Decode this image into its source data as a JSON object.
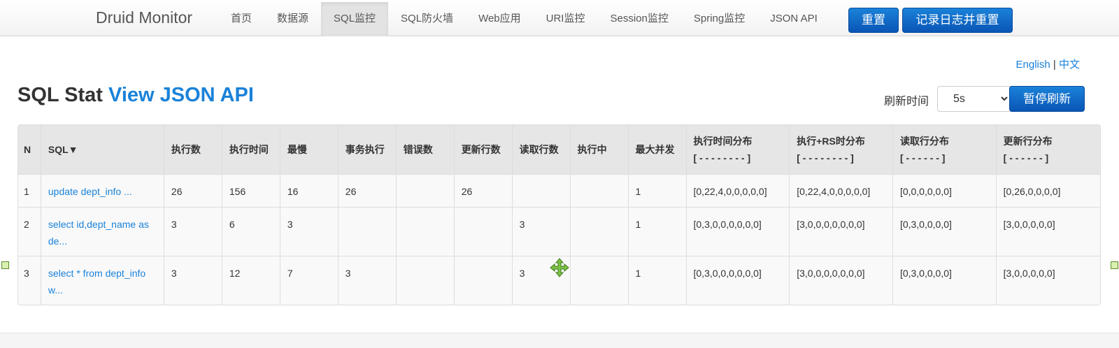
{
  "navbar": {
    "brand": "Druid Monitor",
    "items": [
      {
        "label": "首页"
      },
      {
        "label": "数据源"
      },
      {
        "label": "SQL监控"
      },
      {
        "label": "SQL防火墙"
      },
      {
        "label": "Web应用"
      },
      {
        "label": "URI监控"
      },
      {
        "label": "Session监控"
      },
      {
        "label": "Spring监控"
      },
      {
        "label": "JSON API"
      }
    ],
    "active_item": "SQL监控",
    "reset_label": "重置",
    "log_reset_label": "记录日志并重置"
  },
  "lang": {
    "english": "English",
    "separator": "|",
    "chinese": "中文"
  },
  "header": {
    "title": "SQL Stat",
    "api_link": "View JSON API",
    "refresh_label": "刷新时间",
    "refresh_value": "5s",
    "pause_label": "暂停刷新"
  },
  "table": {
    "headers": {
      "n": "N",
      "sql": "SQL▼",
      "exec_count": "执行数",
      "exec_time": "执行时间",
      "slowest": "最慢",
      "tx_exec": "事务执行",
      "error_count": "错误数",
      "update_rows": "更新行数",
      "fetch_rows": "读取行数",
      "running": "执行中",
      "max_concurrent": "最大并发",
      "exec_hist_title": "执行时间分布",
      "exec_hist_sub": "[ - - - - - - - - ]",
      "exec_rs_hist_title": "执行+RS时分布",
      "exec_rs_hist_sub": "[ - - - - - - - - ]",
      "fetch_hist_title": "读取行分布",
      "fetch_hist_sub": "[ - - - - - - ]",
      "update_hist_title": "更新行分布",
      "update_hist_sub": "[ - - - - - - ]"
    },
    "rows": [
      {
        "n": "1",
        "sql": "update dept_info ...",
        "exec_count": "26",
        "exec_time": "156",
        "slowest": "16",
        "tx_exec": "26",
        "error_count": "",
        "update_rows": "26",
        "fetch_rows": "",
        "running": "",
        "max_concurrent": "1",
        "exec_hist": "[0,22,4,0,0,0,0,0]",
        "exec_rs_hist": "[0,22,4,0,0,0,0,0]",
        "fetch_hist": "[0,0,0,0,0,0]",
        "update_hist": "[0,26,0,0,0,0]"
      },
      {
        "n": "2",
        "sql": "select id,dept_name as de...",
        "exec_count": "3",
        "exec_time": "6",
        "slowest": "3",
        "tx_exec": "",
        "error_count": "",
        "update_rows": "",
        "fetch_rows": "3",
        "running": "",
        "max_concurrent": "1",
        "exec_hist": "[0,3,0,0,0,0,0,0]",
        "exec_rs_hist": "[3,0,0,0,0,0,0,0]",
        "fetch_hist": "[0,3,0,0,0,0]",
        "update_hist": "[3,0,0,0,0,0]"
      },
      {
        "n": "3",
        "sql": "select * from dept_info w...",
        "exec_count": "3",
        "exec_time": "12",
        "slowest": "7",
        "tx_exec": "3",
        "error_count": "",
        "update_rows": "",
        "fetch_rows": "3",
        "running": "",
        "max_concurrent": "1",
        "exec_hist": "[0,3,0,0,0,0,0,0]",
        "exec_rs_hist": "[3,0,0,0,0,0,0,0]",
        "fetch_hist": "[0,3,0,0,0,0]",
        "update_hist": "[3,0,0,0,0,0]"
      }
    ]
  },
  "colors": {
    "primary": "#1a82d9",
    "header_bg": "#e6e6e6"
  }
}
